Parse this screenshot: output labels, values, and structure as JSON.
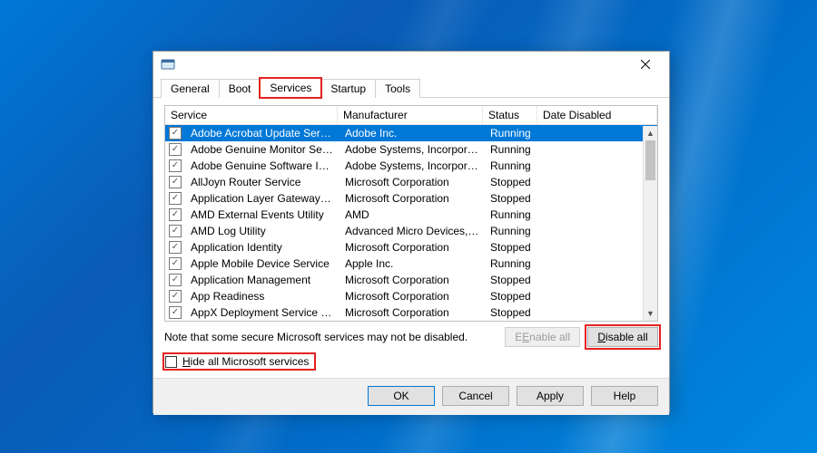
{
  "window": {
    "title": ""
  },
  "tabs": {
    "items": [
      "General",
      "Boot",
      "Services",
      "Startup",
      "Tools"
    ],
    "active_index": 2,
    "highlight_index": 2
  },
  "columns": {
    "service": "Service",
    "manufacturer": "Manufacturer",
    "status": "Status",
    "date_disabled": "Date Disabled"
  },
  "rows": [
    {
      "checked": true,
      "selected": true,
      "service": "Adobe Acrobat Update Service",
      "manufacturer": "Adobe Inc.",
      "status": "Running",
      "date_disabled": ""
    },
    {
      "checked": true,
      "selected": false,
      "service": "Adobe Genuine Monitor Service",
      "manufacturer": "Adobe Systems, Incorpora...",
      "status": "Running",
      "date_disabled": ""
    },
    {
      "checked": true,
      "selected": false,
      "service": "Adobe Genuine Software Integri...",
      "manufacturer": "Adobe Systems, Incorpora...",
      "status": "Running",
      "date_disabled": ""
    },
    {
      "checked": true,
      "selected": false,
      "service": "AllJoyn Router Service",
      "manufacturer": "Microsoft Corporation",
      "status": "Stopped",
      "date_disabled": ""
    },
    {
      "checked": true,
      "selected": false,
      "service": "Application Layer Gateway Service",
      "manufacturer": "Microsoft Corporation",
      "status": "Stopped",
      "date_disabled": ""
    },
    {
      "checked": true,
      "selected": false,
      "service": "AMD External Events Utility",
      "manufacturer": "AMD",
      "status": "Running",
      "date_disabled": ""
    },
    {
      "checked": true,
      "selected": false,
      "service": "AMD Log Utility",
      "manufacturer": "Advanced Micro Devices, I...",
      "status": "Running",
      "date_disabled": ""
    },
    {
      "checked": true,
      "selected": false,
      "service": "Application Identity",
      "manufacturer": "Microsoft Corporation",
      "status": "Stopped",
      "date_disabled": ""
    },
    {
      "checked": true,
      "selected": false,
      "service": "Apple Mobile Device Service",
      "manufacturer": "Apple Inc.",
      "status": "Running",
      "date_disabled": ""
    },
    {
      "checked": true,
      "selected": false,
      "service": "Application Management",
      "manufacturer": "Microsoft Corporation",
      "status": "Stopped",
      "date_disabled": ""
    },
    {
      "checked": true,
      "selected": false,
      "service": "App Readiness",
      "manufacturer": "Microsoft Corporation",
      "status": "Stopped",
      "date_disabled": ""
    },
    {
      "checked": true,
      "selected": false,
      "service": "AppX Deployment Service (AppX...",
      "manufacturer": "Microsoft Corporation",
      "status": "Stopped",
      "date_disabled": ""
    }
  ],
  "note": "Note that some secure Microsoft services may not be disabled.",
  "buttons": {
    "enable_all": "Enable all",
    "disable_all": "Disable all",
    "ok": "OK",
    "cancel": "Cancel",
    "apply": "Apply",
    "help": "Help"
  },
  "hide_checkbox": {
    "label_pre": "H",
    "label_post": "ide all Microsoft services",
    "checked": false
  },
  "checkmark": "✓"
}
